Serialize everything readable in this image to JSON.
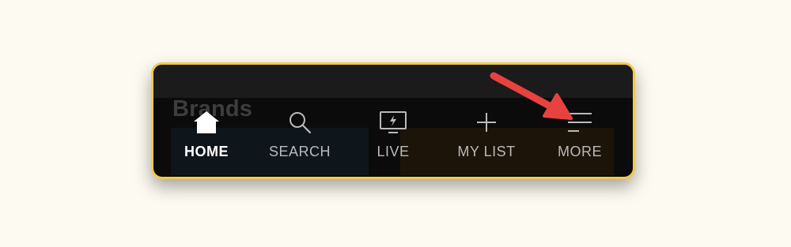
{
  "background_partial": {
    "heading": "Brands"
  },
  "tab_bar": {
    "active": "home",
    "tabs": [
      {
        "id": "home",
        "label": "HOME",
        "icon": "home-icon"
      },
      {
        "id": "search",
        "label": "SEARCH",
        "icon": "search-icon"
      },
      {
        "id": "live",
        "label": "LIVE",
        "icon": "live-tv-icon"
      },
      {
        "id": "mylist",
        "label": "MY LIST",
        "icon": "plus-icon"
      },
      {
        "id": "more",
        "label": "MORE",
        "icon": "menu-icon"
      }
    ]
  },
  "colors": {
    "page_background": "#fdfaf1",
    "frame_border": "#f2c94c",
    "bar_background": "#0b0b0b",
    "active_label": "#ffffff",
    "inactive_label": "#b9b9b9",
    "annotation_arrow": "#e8423f"
  },
  "annotation": {
    "type": "arrow",
    "points_to": "more"
  }
}
